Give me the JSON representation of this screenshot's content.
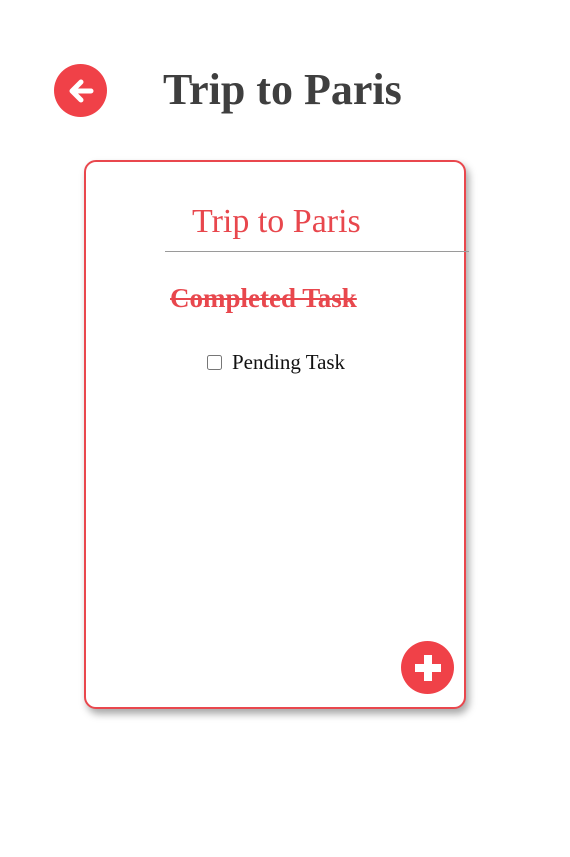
{
  "header": {
    "title": "Trip to Paris",
    "back_icon": "arrow-left-circle-icon"
  },
  "card": {
    "list_title_value": "Trip to Paris",
    "completed_tasks": [
      "Completed Task"
    ],
    "pending_tasks": [
      {
        "label": "Pending Task",
        "checked": false
      }
    ],
    "add_icon": "plus-circle-icon"
  },
  "colors": {
    "accent": "#f04148",
    "title_text": "#3f3f3f",
    "card_border": "#e9474d"
  }
}
